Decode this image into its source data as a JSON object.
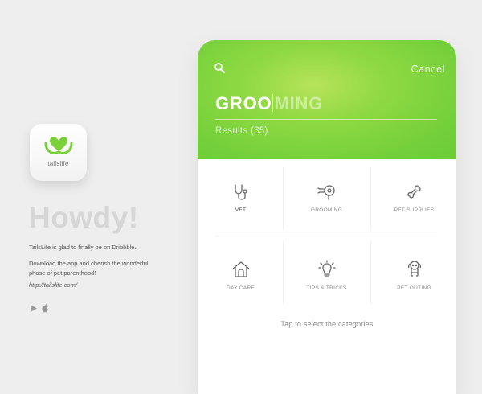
{
  "app": {
    "brand_name": "tailslife",
    "accent_color": "#7ad03a"
  },
  "intro": {
    "heading": "Howdy!",
    "line1": "TailsLife is glad to finally be on Dribbble.",
    "line2": "Download the app and cherish the wonderful phase of pet parenthood!",
    "link": "http://tailslife.com/",
    "store_icons": [
      "play-store-icon",
      "apple-icon"
    ]
  },
  "search": {
    "typed": "GROO",
    "suggestion": "MING",
    "cancel_label": "Cancel",
    "results_label": "Results (35)"
  },
  "categories": [
    {
      "label": "VET",
      "icon": "stethoscope-icon",
      "active": true
    },
    {
      "label": "GROOMING",
      "icon": "hair-dryer-icon",
      "active": false
    },
    {
      "label": "PET SUPPLIES",
      "icon": "bone-icon",
      "active": false
    },
    {
      "label": "DAY CARE",
      "icon": "dog-house-icon",
      "active": false
    },
    {
      "label": "TIPS & TRICKS",
      "icon": "lightbulb-icon",
      "active": false
    },
    {
      "label": "PET OUTING",
      "icon": "dog-icon",
      "active": false
    }
  ],
  "hint": "Tap to select the categories"
}
